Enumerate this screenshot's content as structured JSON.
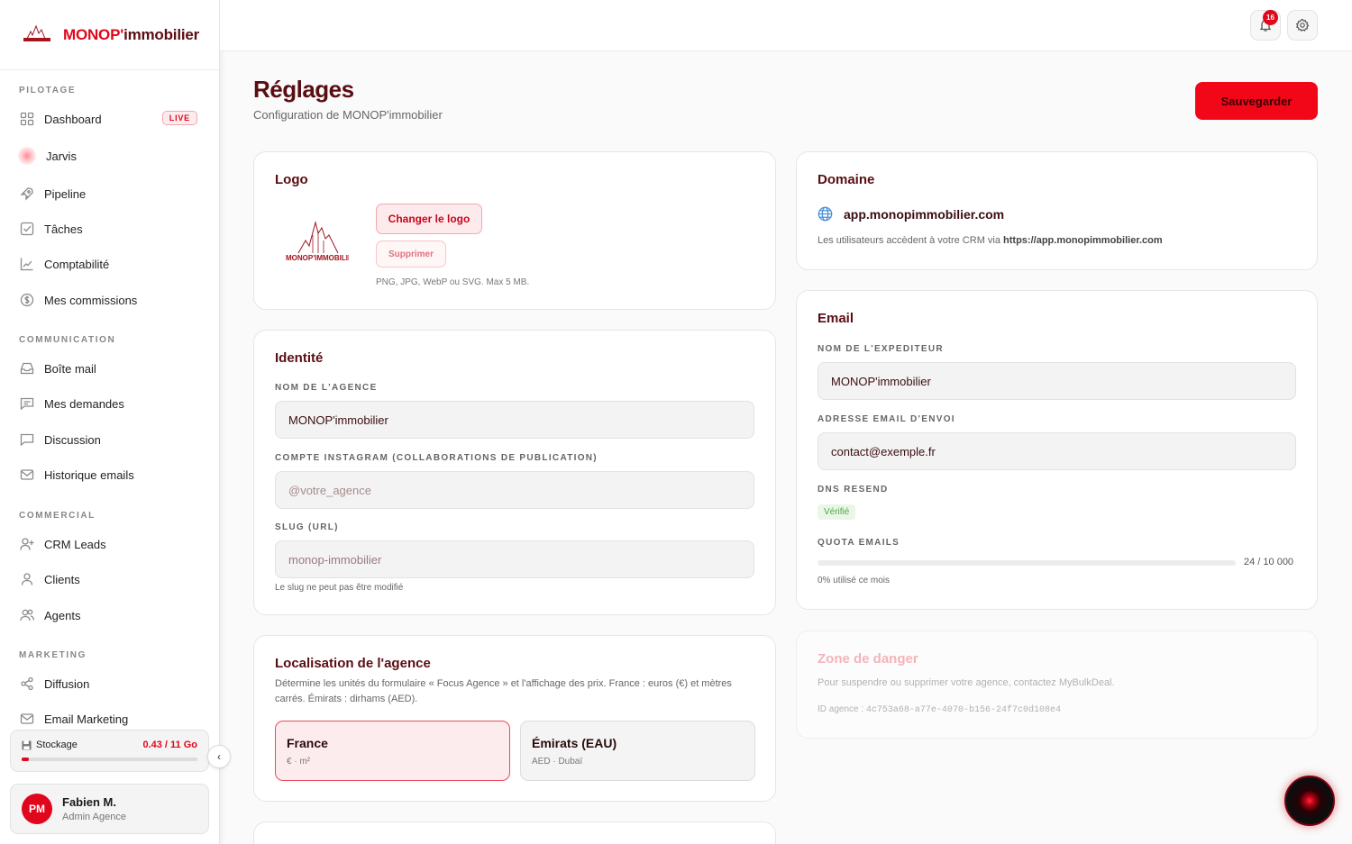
{
  "brand": {
    "name_red": "MONOP'",
    "name_dark": "immobilier",
    "logo_text": "MONOP'IMMOBILIER"
  },
  "sidebar": {
    "sections": {
      "pilotage": "PILOTAGE",
      "communication": "COMMUNICATION",
      "commercial": "COMMERCIAL",
      "marketing": "MARKETING"
    },
    "items": {
      "dashboard": "Dashboard",
      "live": "LIVE",
      "jarvis": "Jarvis",
      "pipeline": "Pipeline",
      "taches": "Tâches",
      "comptabilite": "Comptabilité",
      "commissions": "Mes commissions",
      "boite_mail": "Boîte mail",
      "demandes": "Mes demandes",
      "discussion": "Discussion",
      "historique": "Historique emails",
      "crm_leads": "CRM Leads",
      "clients": "Clients",
      "agents": "Agents",
      "diffusion": "Diffusion",
      "email_marketing": "Email Marketing"
    },
    "storage": {
      "label": "Stockage",
      "value": "0.43 / 11 Go",
      "fraction": 0.04
    },
    "user": {
      "initials": "PM",
      "name": "Fabien M.",
      "role": "Admin Agence"
    }
  },
  "topbar": {
    "notif_count": "16"
  },
  "page": {
    "title": "Réglages",
    "subtitle": "Configuration de MONOP'immobilier",
    "save": "Sauvegarder"
  },
  "logo_card": {
    "title": "Logo",
    "change": "Changer le logo",
    "delete": "Supprimer",
    "hint": "PNG, JPG, WebP ou SVG. Max 5 MB."
  },
  "identity": {
    "title": "Identité",
    "agency_label": "NOM DE L'AGENCE",
    "agency_value": "MONOP'immobilier",
    "instagram_label": "COMPTE INSTAGRAM (COLLABORATIONS DE PUBLICATION)",
    "instagram_placeholder": "@votre_agence",
    "slug_label": "SLUG (URL)",
    "slug_value": "monop-immobilier",
    "slug_hint": "Le slug ne peut pas être modifié"
  },
  "localisation": {
    "title": "Localisation de l'agence",
    "desc": "Détermine les unités du formulaire « Focus Agence » et l'affichage des prix. France : euros (€) et mètres carrés. Émirats : dirhams (AED).",
    "france_name": "France",
    "france_unit": "€ · m²",
    "emirats_name": "Émirats (EAU)",
    "emirats_unit": "AED · Dubaï"
  },
  "domain": {
    "title": "Domaine",
    "value": "app.monopimmobilier.com",
    "desc_prefix": "Les utilisateurs accèdent à votre CRM via ",
    "desc_url": "https://app.monopimmobilier.com"
  },
  "email": {
    "title": "Email",
    "sender_label": "NOM DE L'EXPEDITEUR",
    "sender_value": "MONOP'immobilier",
    "address_label": "ADRESSE EMAIL D'ENVOI",
    "address_value": "contact@exemple.fr",
    "dns_label": "DNS RESEND",
    "dns_status": "Vérifié",
    "quota_label": "QUOTA EMAILS",
    "quota_value": "24 / 10 000",
    "quota_hint": "0% utilisé ce mois"
  },
  "danger": {
    "title": "Zone de danger",
    "desc": "Pour suspendre ou supprimer votre agence, contactez MyBulkDeal.",
    "id_label": "ID agence : ",
    "id_value": "4c753a68-a77e-4070-b156-24f7c0d108e4"
  },
  "colors": {
    "accent": "#e1061b",
    "title": "#5a0d12"
  }
}
